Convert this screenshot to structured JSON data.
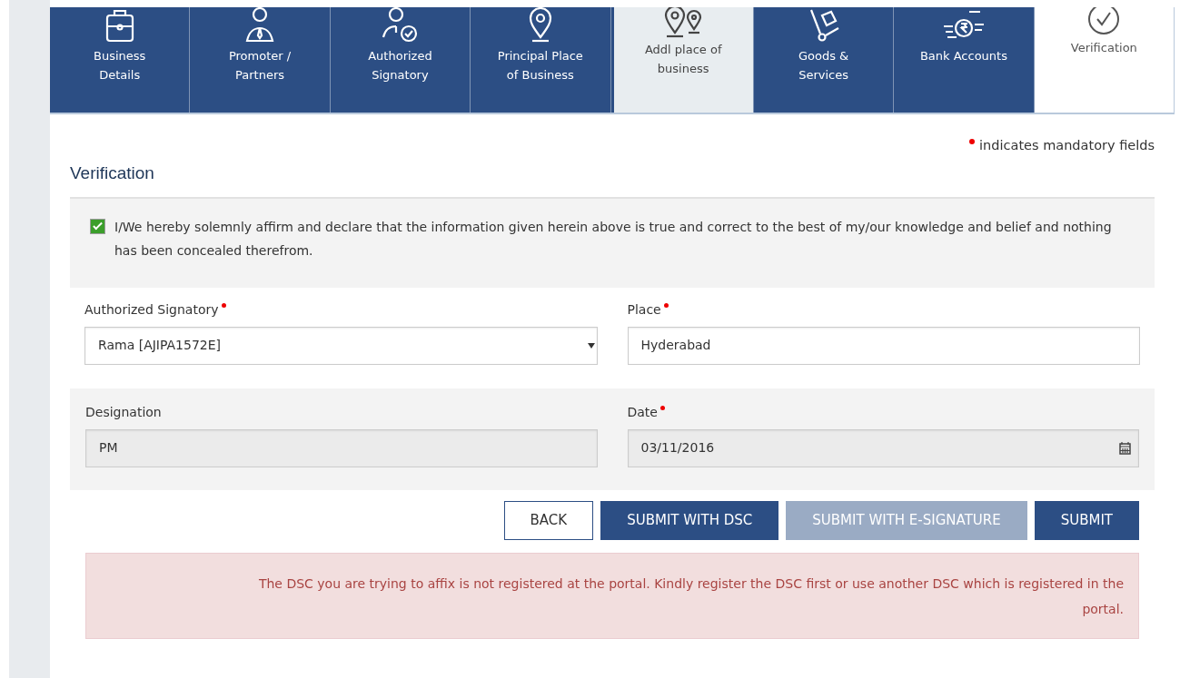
{
  "tabs": [
    {
      "label": "Business Details",
      "completed": true,
      "selected": false
    },
    {
      "label": "Promoter / Partners",
      "completed": true,
      "selected": false
    },
    {
      "label": "Authorized Signatory",
      "completed": true,
      "selected": false
    },
    {
      "label": "Principal Place of Business",
      "completed": true,
      "selected": false
    },
    {
      "label": "Addl place of business",
      "completed": false,
      "selected": false
    },
    {
      "label": "Goods & Services",
      "completed": true,
      "selected": false
    },
    {
      "label": "Bank Accounts",
      "completed": true,
      "selected": false
    },
    {
      "label": "Verification",
      "selected": true
    }
  ],
  "mandatory_note": "indicates mandatory fields",
  "section_title": "Verification",
  "declaration": {
    "checked": true,
    "text": "I/We hereby solemnly affirm and declare that the information given herein above is true and correct to the best of my/our knowledge and belief and nothing has been concealed therefrom."
  },
  "fields": [
    {
      "label": "Authorized Signatory",
      "required": true,
      "kind": "select",
      "value": "Rama [AJIPA1572E]",
      "disabled": false
    },
    {
      "label": "Place",
      "required": true,
      "kind": "text",
      "value": "Hyderabad",
      "disabled": false
    },
    {
      "label": "Designation",
      "required": false,
      "kind": "text",
      "value": "PM",
      "disabled": true
    },
    {
      "label": "Date",
      "required": true,
      "kind": "date",
      "value": "03/11/2016",
      "disabled": true
    }
  ],
  "buttons": [
    {
      "label": "BACK",
      "kind": "outline",
      "disabled": false
    },
    {
      "label": "SUBMIT WITH DSC",
      "kind": "primary",
      "disabled": false
    },
    {
      "label": "SUBMIT WITH E-SIGNATURE",
      "kind": "primary",
      "disabled": true
    },
    {
      "label": "SUBMIT",
      "kind": "primary",
      "disabled": false
    }
  ],
  "alert": "The DSC you are trying to affix is not registered at the portal. Kindly register the DSC first or use another DSC which is registered in the portal."
}
